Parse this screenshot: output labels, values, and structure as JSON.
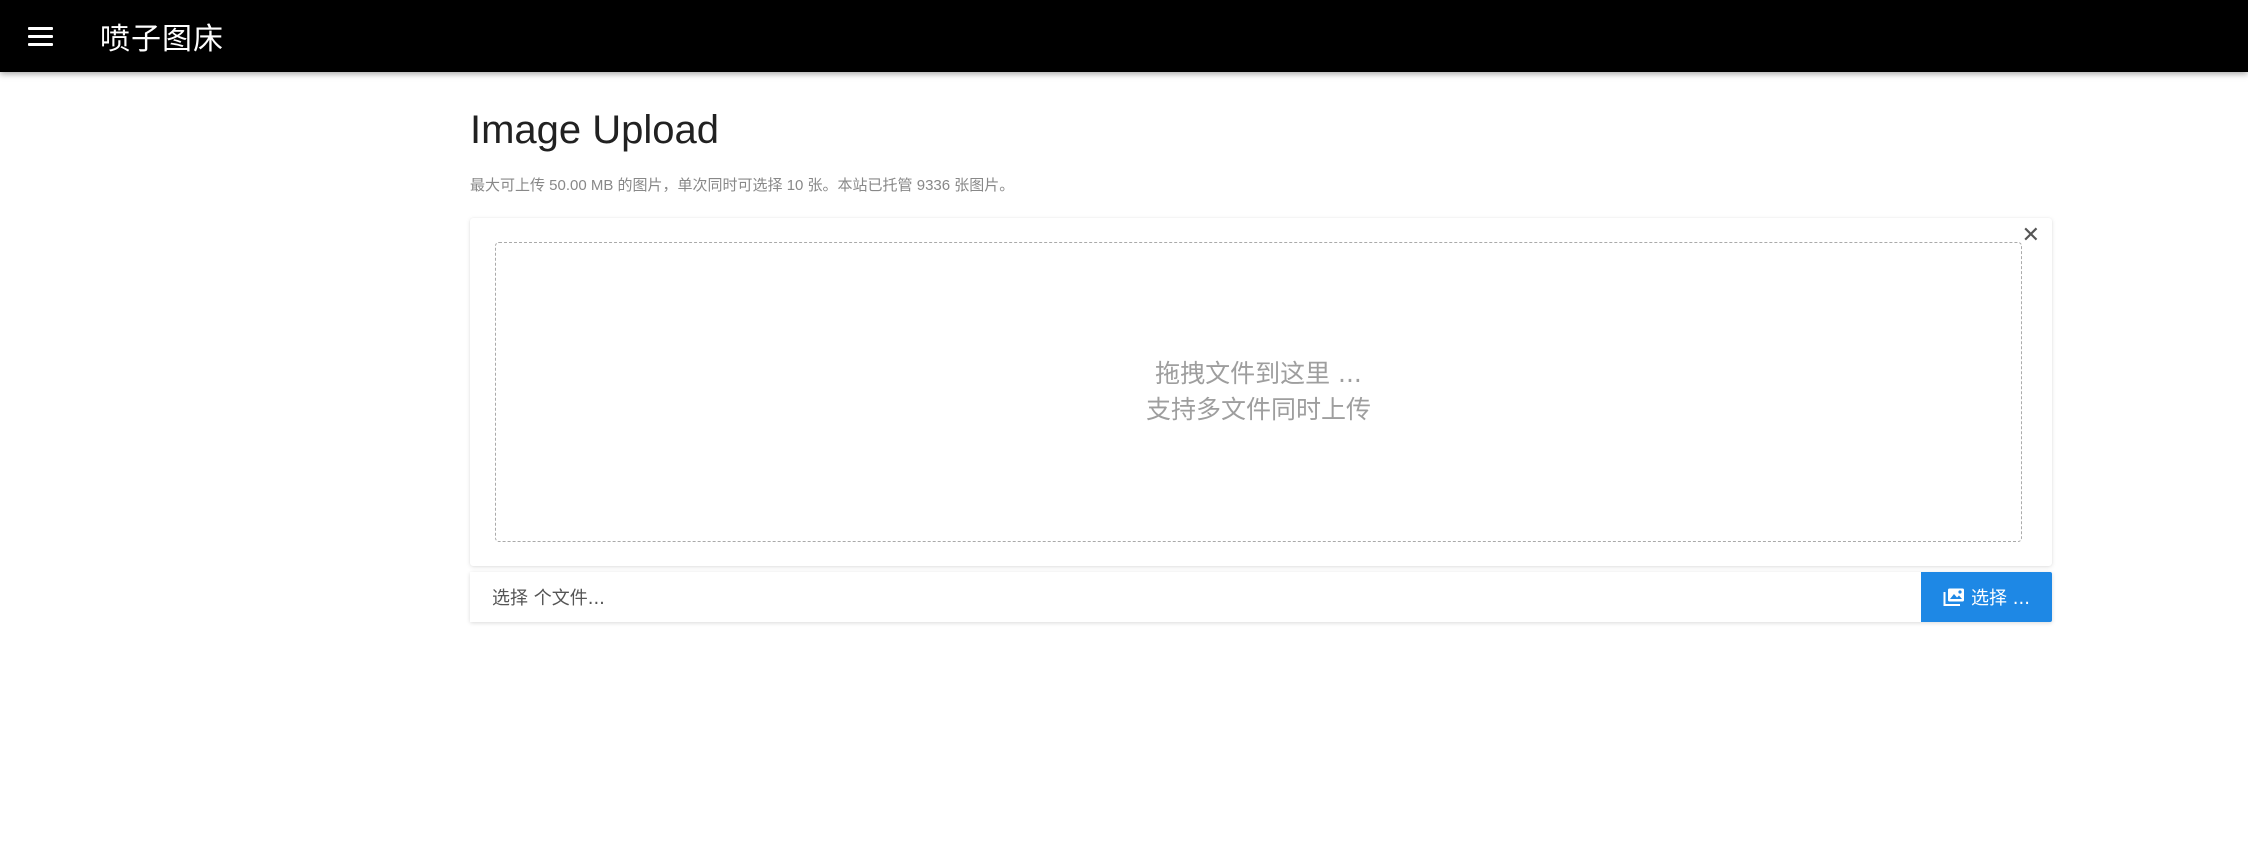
{
  "appbar": {
    "menu_icon": "hamburger-menu-icon",
    "title": "喷子图床"
  },
  "main": {
    "title": "Image Upload",
    "subtitle": "最大可上传 50.00 MB 的图片，单次同时可选择 10 张。本站已托管 9336 张图片。"
  },
  "dropzone": {
    "close_icon": "close-icon",
    "line1": "拖拽文件到这里 ...",
    "line2": "支持多文件同时上传"
  },
  "file_input": {
    "caption": "选择 个文件...",
    "browse_label": "选择 ...",
    "browse_icon": "images-icon"
  },
  "colors": {
    "appbar_bg": "#000000",
    "accent": "#1e88e5"
  }
}
